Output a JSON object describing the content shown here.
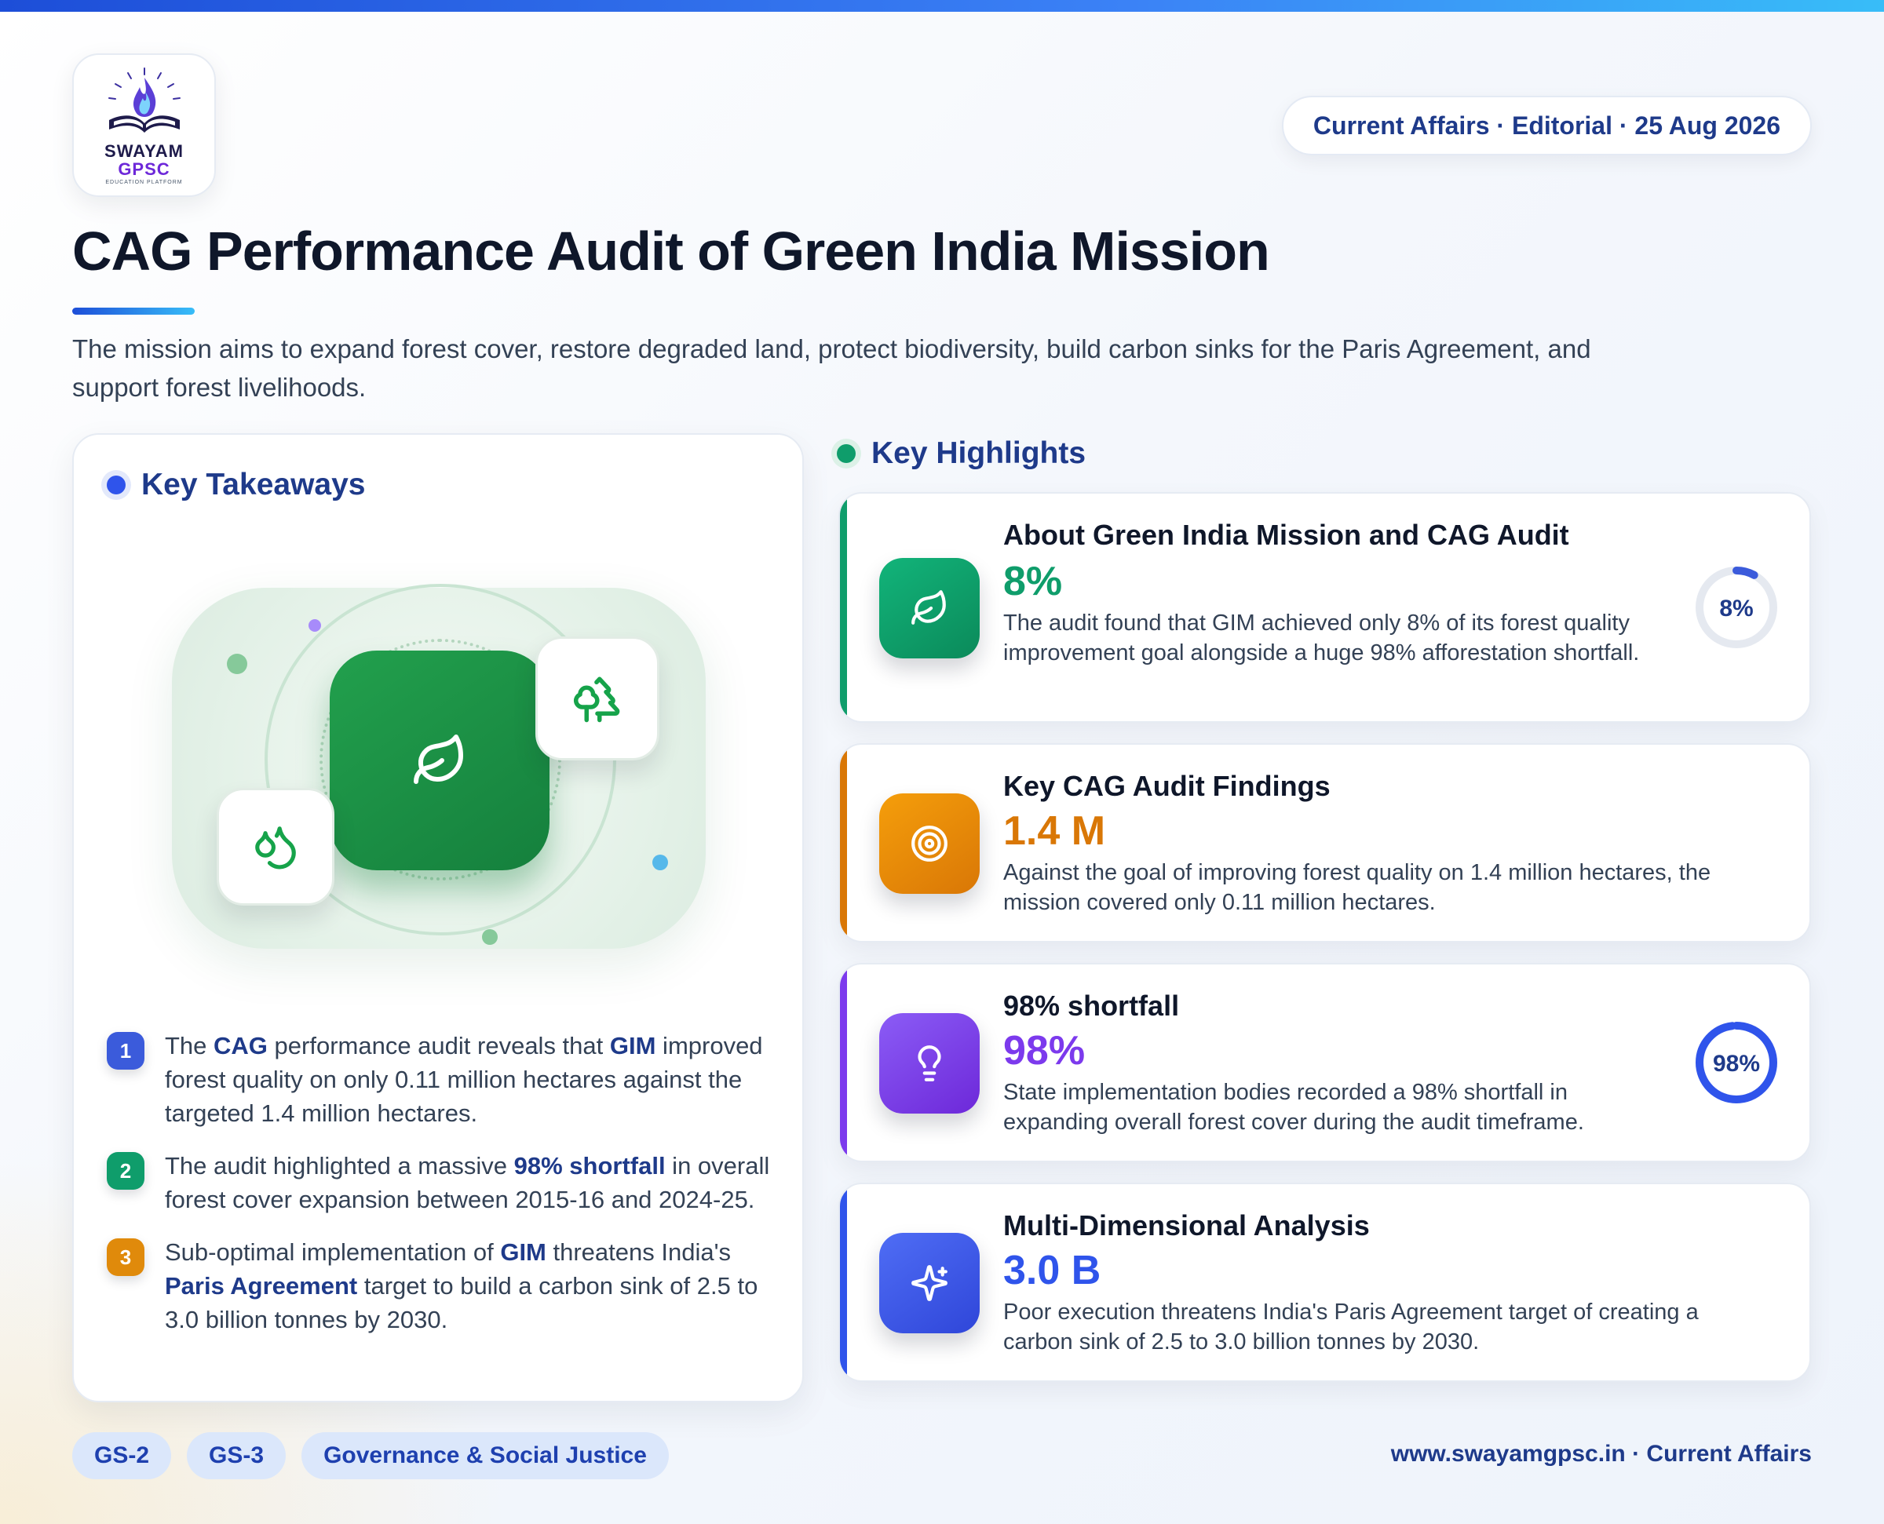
{
  "header": {
    "logo": {
      "name": "SWAYAM",
      "name2": "GPSC",
      "tagline": "EDUCATION PLATFORM"
    },
    "date_pill": "Current Affairs · Editorial · 25 Aug 2026",
    "title": "CAG Performance Audit of Green India Mission",
    "intro": "The mission aims to expand forest cover, restore degraded land, protect biodiversity, build carbon sinks for the Paris Agreement, and support forest livelihoods."
  },
  "takeaways": {
    "heading": "Key Takeaways",
    "accent": "#2f54eb",
    "items": [
      {
        "number": "1",
        "color": "#3b5bdb",
        "parts": [
          [
            "The ",
            false
          ],
          [
            "CAG",
            true
          ],
          [
            " performance audit reveals that ",
            false
          ],
          [
            "GIM",
            true
          ],
          [
            " improved forest quality on only 0.11 million hectares against the targeted 1.4 million hectares.",
            false
          ]
        ]
      },
      {
        "number": "2",
        "color": "#0f9d6b",
        "parts": [
          [
            "The audit highlighted a massive ",
            false
          ],
          [
            "98% shortfall",
            true
          ],
          [
            " in overall forest cover expansion between 2015-16 and 2024-25.",
            false
          ]
        ]
      },
      {
        "number": "3",
        "color": "#e08a0b",
        "parts": [
          [
            "Sub-optimal implementation of ",
            false
          ],
          [
            "GIM",
            true
          ],
          [
            " threatens India's ",
            false
          ],
          [
            "Paris Agreement",
            true
          ],
          [
            " target to build a carbon sink of 2.5 to 3.0 billion tonnes by 2030.",
            false
          ]
        ]
      }
    ],
    "hero_icons": [
      "leaf-icon",
      "trees-icon",
      "droplets-icon"
    ]
  },
  "highlights": {
    "heading": "Key Highlights",
    "accent": "#0f9d6b",
    "cards": [
      {
        "title": "About Green India Mission and CAG Audit",
        "stat": "8%",
        "description": "The audit found that GIM achieved only 8% of its forest quality improvement goal alongside a huge 98% afforestation shortfall.",
        "icon": "leaf-icon",
        "color": "#0f9d6b",
        "gradient": [
          "#12b47a",
          "#0b8a5a"
        ],
        "gauge": {
          "label": "8%",
          "fraction": 0.08,
          "ring": "#3b5bdb",
          "text_color": "#1e3a8a"
        }
      },
      {
        "title": "Key CAG Audit Findings",
        "stat": "1.4 M",
        "description": "Against the goal of improving forest quality on 1.4 million hectares, the mission covered only 0.11 million hectares.",
        "icon": "target-icon",
        "color": "#d97706",
        "gradient": [
          "#f59e0b",
          "#d97706"
        ],
        "gauge": null
      },
      {
        "title": "98% shortfall",
        "stat": "98%",
        "description": "State implementation bodies recorded a 98% shortfall in expanding overall forest cover during the audit timeframe.",
        "icon": "lightbulb-icon",
        "color": "#7c3aed",
        "gradient": [
          "#8b5cf6",
          "#6d28d9"
        ],
        "gauge": {
          "label": "98%",
          "fraction": 0.98,
          "ring": "#2f54eb",
          "text_color": "#1e3a8a"
        }
      },
      {
        "title": "Multi-Dimensional Analysis",
        "stat": "3.0 B",
        "description": "Poor execution threatens India's Paris Agreement target of creating a carbon sink of 2.5 to 3.0 billion tonnes by 2030.",
        "icon": "sparkles-icon",
        "color": "#2f54eb",
        "gradient": [
          "#4f6df5",
          "#2f46d9"
        ],
        "gauge": null
      }
    ]
  },
  "footer": {
    "tags": [
      "GS-2",
      "GS-3",
      "Governance & Social Justice"
    ],
    "site": "www.swayamgpsc.in · Current Affairs"
  }
}
